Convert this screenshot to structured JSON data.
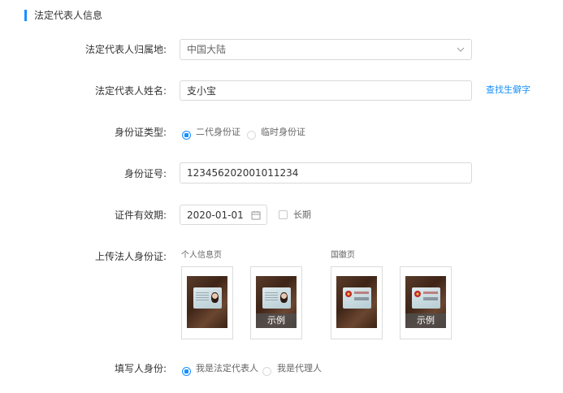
{
  "section": {
    "title": "法定代表人信息"
  },
  "form": {
    "region": {
      "label": "法定代表人归属地:",
      "value": "中国大陆"
    },
    "name": {
      "label": "法定代表人姓名:",
      "value": "支小宝",
      "link": "查找生僻字"
    },
    "id_type": {
      "label": "身份证类型:",
      "options": [
        "二代身份证",
        "临时身份证"
      ],
      "selected": "二代身份证"
    },
    "id_number": {
      "label": "身份证号:",
      "value": "123456202001011234"
    },
    "validity": {
      "label": "证件有效期:",
      "date": "2020-01-01",
      "long_term_label": "长期",
      "long_term_checked": false
    },
    "upload": {
      "label": "上传法人身份证:",
      "groups": [
        {
          "caption": "个人信息页",
          "sample_label": "示例"
        },
        {
          "caption": "国徽页",
          "sample_label": "示例"
        }
      ]
    },
    "filler_identity": {
      "label": "填写人身份:",
      "options": [
        "我是法定代表人",
        "我是代理人"
      ],
      "selected": "我是法定代表人"
    }
  },
  "colors": {
    "accent": "#1890ff",
    "border": "#d9d9d9",
    "text": "#333333"
  }
}
